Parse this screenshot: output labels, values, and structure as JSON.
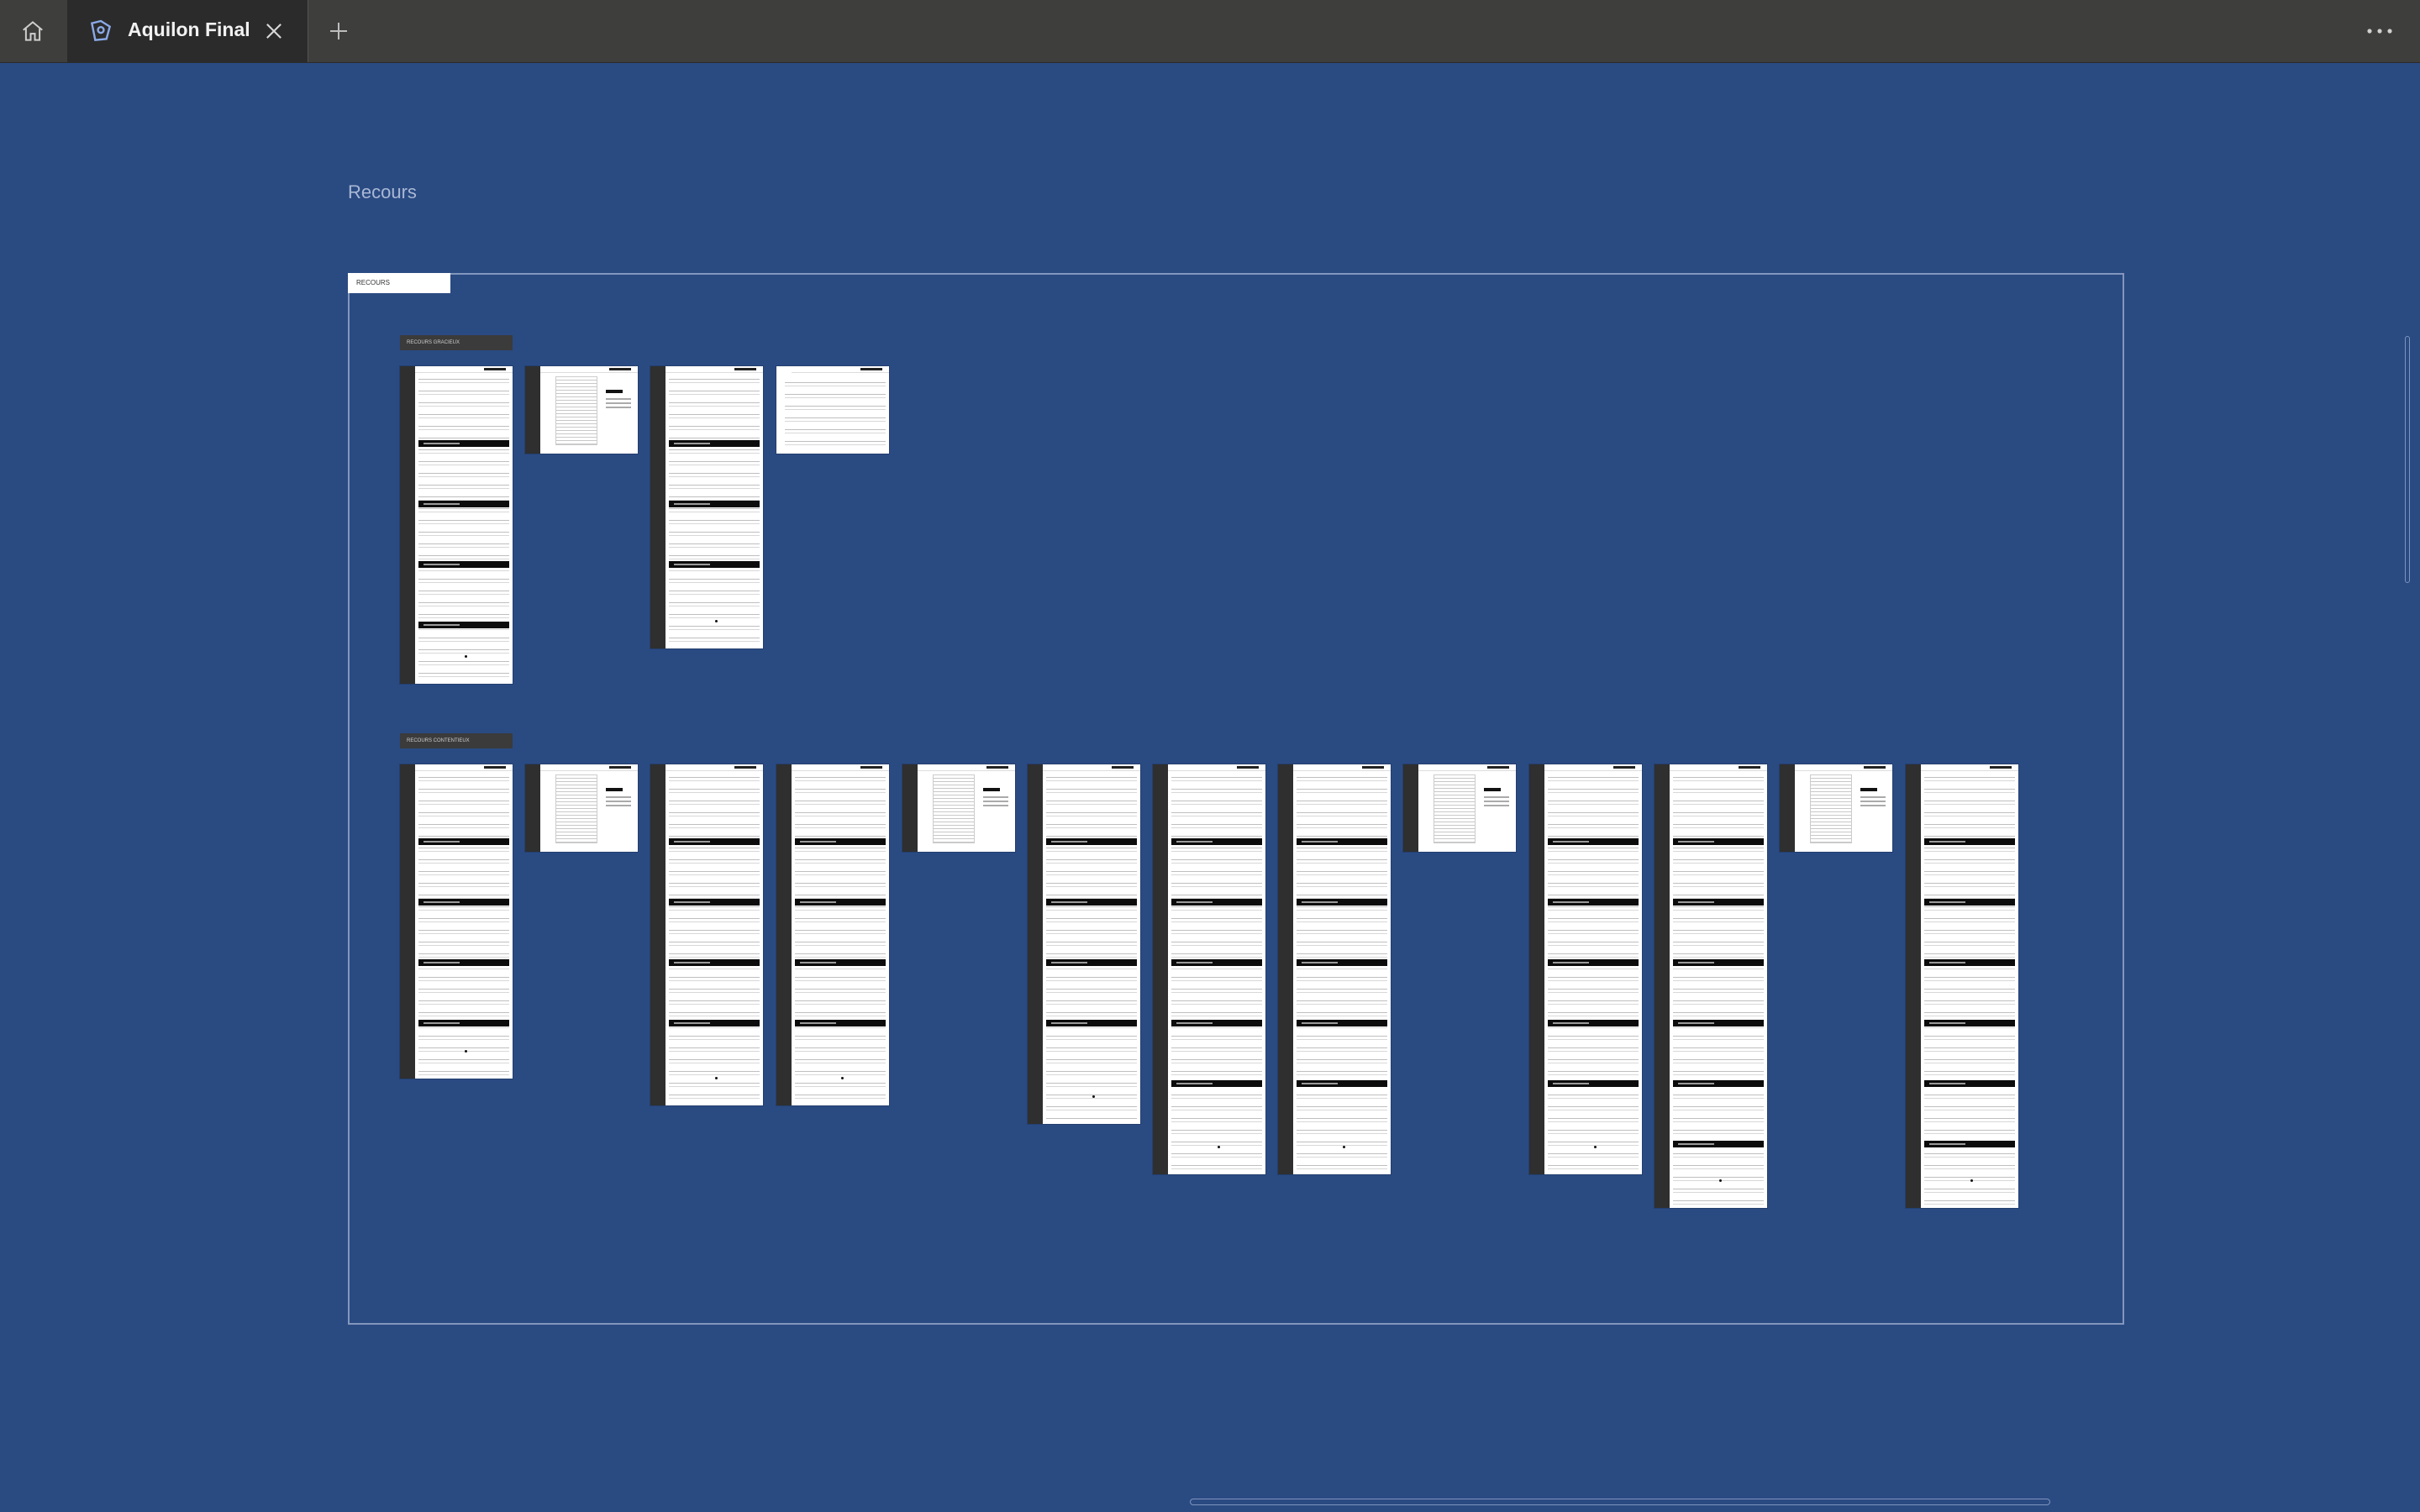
{
  "tabbar": {
    "home_icon": "home-icon",
    "tab": {
      "title": "Aquilon Final",
      "icon": "design-file-icon",
      "close_icon": "close-icon"
    },
    "add_tab_icon": "plus-icon",
    "more_icon": "more-horizontal-icon"
  },
  "canvas": {
    "background": "#2a4a82",
    "section": {
      "title": "Recours",
      "badge": "RECOURS",
      "groups": [
        {
          "label": "RECOURS GRACIEUX",
          "screens": 4
        },
        {
          "label": "RECOURS CONTENTIEUX",
          "screens": 13
        }
      ]
    }
  }
}
